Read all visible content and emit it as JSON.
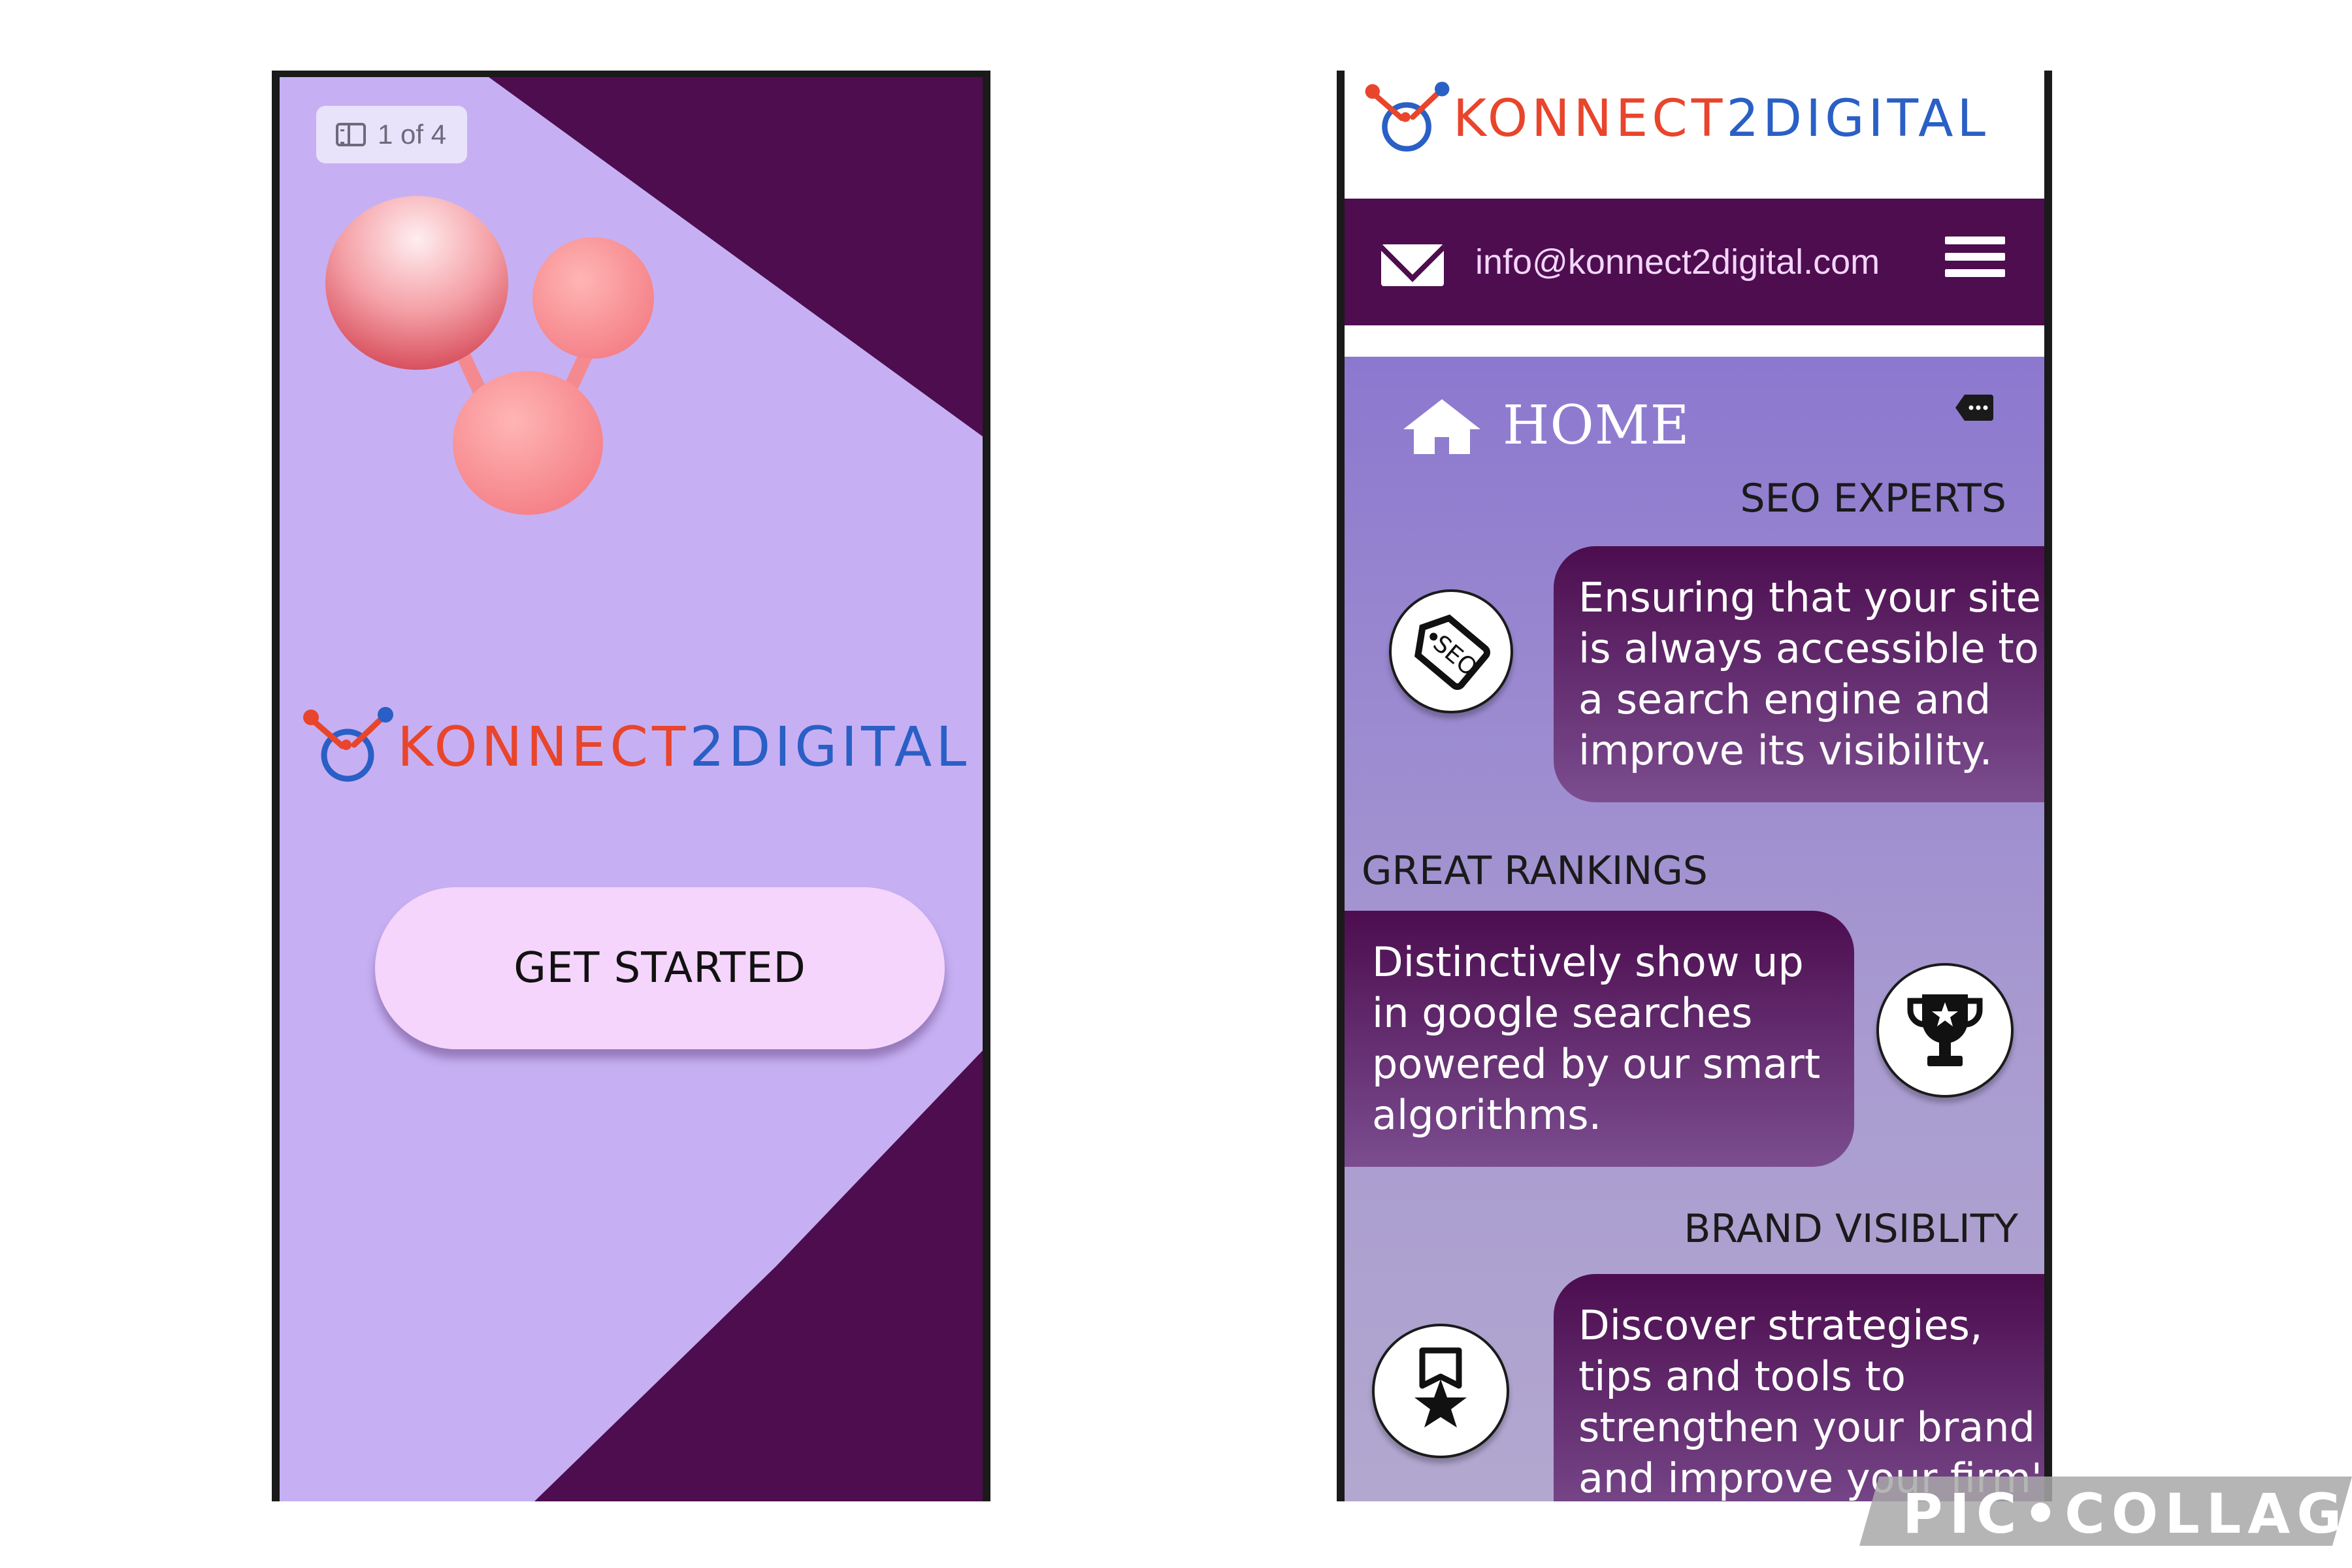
{
  "left_screen": {
    "page_indicator": "1 of 4",
    "brand": {
      "part1": "KONNECT",
      "part2": "2DIGITAL"
    },
    "cta_label": "GET STARTED"
  },
  "right_screen": {
    "brand": {
      "part1": "KONNECT",
      "part2": "2DIGITAL"
    },
    "email": "info@konnect2digital.com",
    "nav_title": "HOME",
    "sections": [
      {
        "title": "SEO EXPERTS",
        "text": "Ensuring that your site is always accessible to a search engine and improve its visibility.",
        "icon": "seo-tag-icon",
        "icon_text": "SEO"
      },
      {
        "title": "GREAT RANKINGS",
        "text": "Distinctively show up in google searches powered by our smart algorithms.",
        "icon": "trophy-icon"
      },
      {
        "title": "BRAND VISIBLITY",
        "text": "Discover strategies, tips and tools to strengthen your brand and improve your firm's reputation.",
        "icon": "badge-star-icon"
      }
    ]
  },
  "watermark": "PIC•COLLAGE",
  "colors": {
    "lavender": "#c6b0f3",
    "plum": "#4d0d4e",
    "brand_orange": "#e8452c",
    "brand_blue": "#2a5fc5",
    "button_pink": "#f5d5fb"
  }
}
